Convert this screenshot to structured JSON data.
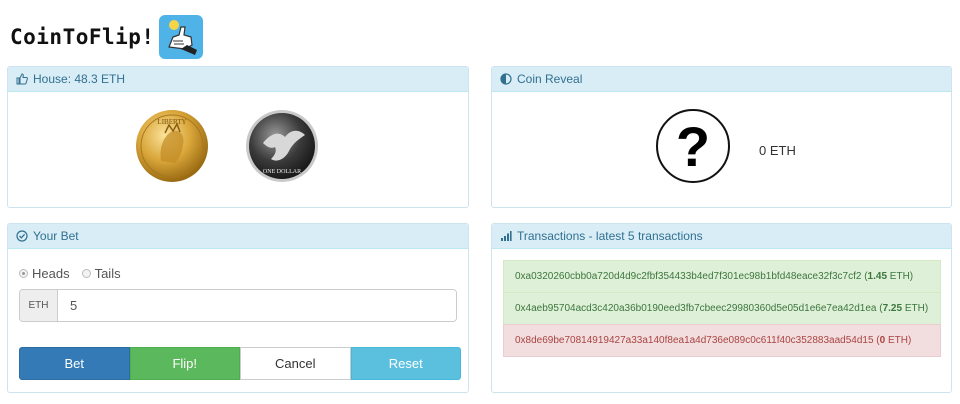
{
  "app": {
    "title": "CoinToFlip!"
  },
  "house_panel": {
    "label": "House: 48.3 ETH",
    "coins": [
      {
        "face": "heads",
        "inscription": "LIBERTY"
      },
      {
        "face": "tails",
        "inscription": "ONE DOLLAR"
      }
    ]
  },
  "reveal_panel": {
    "label": "Coin Reveal",
    "symbol": "?",
    "amount": "0 ETH"
  },
  "bet_panel": {
    "label": "Your Bet",
    "options": [
      {
        "label": "Heads",
        "checked": true
      },
      {
        "label": "Tails",
        "checked": false
      }
    ],
    "currency_addon": "ETH",
    "amount_value": "5",
    "buttons": {
      "bet": "Bet",
      "flip": "Flip!",
      "cancel": "Cancel",
      "reset": "Reset"
    }
  },
  "tx_panel": {
    "label": "Transactions - latest 5 transactions",
    "items": [
      {
        "hash": "0xa0320260cbb0a720d4d9c2fbf354433b4ed7f301ec98b1bfd48eace32f3c7cf2",
        "amount": "1.45",
        "unit": "ETH",
        "status": "win"
      },
      {
        "hash": "0x4aeb95704acd3c420a36b0190eed3fb7cbeec29980360d5e05d1e6e7ea42d1ea",
        "amount": "7.25",
        "unit": "ETH",
        "status": "win"
      },
      {
        "hash": "0x8de69be70814919427a33a140f8ea1a4d736e089c0c611f40c352883aad54d15",
        "amount": "0",
        "unit": "ETH",
        "status": "loss"
      }
    ]
  },
  "colors": {
    "panel_heading_bg": "#d9edf7",
    "panel_heading_text": "#31708f",
    "bet_button": "#337ab7",
    "flip_button": "#5cb85c",
    "reset_button": "#5bc0de",
    "win_row": "#dff0d8",
    "loss_row": "#f2dede"
  },
  "icons": [
    "thumbs-up-icon",
    "half-circle-icon",
    "check-circle-icon",
    "signal-bars-icon"
  ]
}
